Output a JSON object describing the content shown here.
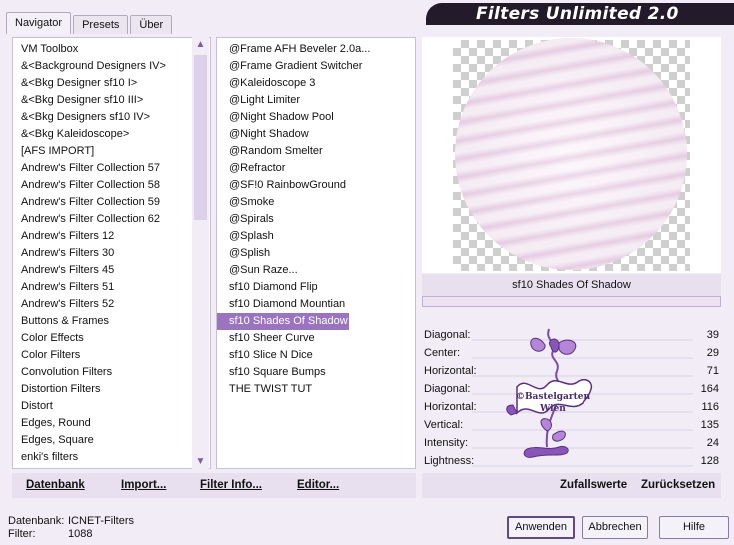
{
  "app": {
    "title": "Filters Unlimited 2.0"
  },
  "tabs": [
    "Navigator",
    "Presets",
    "Über"
  ],
  "categories": [
    "VM Toolbox",
    "&<Background Designers IV>",
    "&<Bkg Designer sf10 I>",
    "&<Bkg Designer sf10 III>",
    "&<Bkg Designers sf10 IV>",
    "&<Bkg Kaleidoscope>",
    "[AFS IMPORT]",
    "Andrew's Filter Collection 57",
    "Andrew's Filter Collection 58",
    "Andrew's Filter Collection 59",
    "Andrew's Filter Collection 62",
    "Andrew's Filters 12",
    "Andrew's Filters 30",
    "Andrew's Filters 45",
    "Andrew's Filters 51",
    "Andrew's Filters 52",
    "Buttons & Frames",
    "Color Effects",
    "Color Filters",
    "Convolution Filters",
    "Distortion Filters",
    "Distort",
    "Edges, Round",
    "Edges, Square",
    "enki's filters"
  ],
  "filters": [
    "@Frame AFH Beveler 2.0a...",
    "@Frame Gradient Switcher",
    "@Kaleidoscope 3",
    "@Light Limiter",
    "@Night Shadow Pool",
    "@Night Shadow",
    "@Random Smelter",
    "@Refractor",
    "@SF!0 RainbowGround",
    "@Smoke",
    "@Spirals",
    "@Splash",
    "@Splish",
    "@Sun Raze...",
    "sf10 Diamond Flip",
    "sf10 Diamond Mountian",
    "sf10 Shades Of Shadow",
    "sf10 Sheer Curve",
    "sf10 Slice N Dice",
    "sf10 Square Bumps",
    "THE TWIST TUT"
  ],
  "selected_filter": "sf10 Shades Of Shadow",
  "left_buttons": {
    "database": "Datenbank",
    "import": "Import...",
    "filter_info": "Filter Info...",
    "editor": "Editor..."
  },
  "preview": {
    "filter_name": "sf10 Shades Of Shadow"
  },
  "params": [
    {
      "label": "Diagonal:",
      "value": "39"
    },
    {
      "label": "Center:",
      "value": "29"
    },
    {
      "label": "Horizontal:",
      "value": "71"
    },
    {
      "label": "Diagonal:",
      "value": "164"
    },
    {
      "label": "Horizontal:",
      "value": "116"
    },
    {
      "label": "Vertical:",
      "value": "135"
    },
    {
      "label": "Intensity:",
      "value": "24"
    },
    {
      "label": "Lightness:",
      "value": "128"
    }
  ],
  "watermark": {
    "line1": "©Bastelgarten",
    "line2": "Wien"
  },
  "right_buttons": {
    "random": "Zufallswerte",
    "reset": "Zurücksetzen"
  },
  "footer": {
    "database_label": "Datenbank:",
    "database_value": "ICNET-Filters",
    "filter_label": "Filter:",
    "filter_value": "1088"
  },
  "dialog_buttons": {
    "apply": "Anwenden",
    "cancel": "Abbrechen",
    "help": "Hilfe"
  },
  "colors": {
    "accent": "#9b74c0",
    "banner": "#231a2a",
    "background": "#f1ecf5"
  },
  "icons": {
    "scroll_up": "chevron-up-icon",
    "scroll_down": "chevron-down-icon"
  }
}
